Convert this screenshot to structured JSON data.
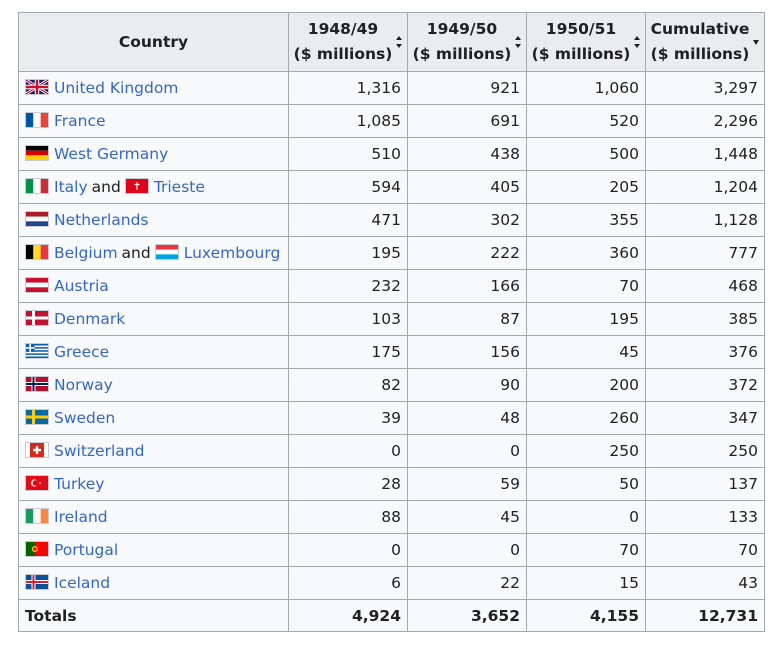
{
  "table": {
    "headers": {
      "country": "Country",
      "y1": [
        "1948/49",
        "($ millions)"
      ],
      "y2": [
        "1949/50",
        "($ millions)"
      ],
      "y3": [
        "1950/51",
        "($ millions)"
      ],
      "cum": [
        "Cumulative",
        "($ millions)"
      ]
    },
    "rows": [
      {
        "parts": [
          {
            "name": "United Kingdom",
            "flag": "uk-flag-icon"
          }
        ],
        "values": [
          "1,316",
          "921",
          "1,060",
          "3,297"
        ]
      },
      {
        "parts": [
          {
            "name": "France",
            "flag": "france-flag-icon"
          }
        ],
        "values": [
          "1,085",
          "691",
          "520",
          "2,296"
        ]
      },
      {
        "parts": [
          {
            "name": "West Germany",
            "flag": "germany-flag-icon"
          }
        ],
        "values": [
          "510",
          "438",
          "500",
          "1,448"
        ]
      },
      {
        "parts": [
          {
            "name": "Italy",
            "flag": "italy-flag-icon"
          },
          {
            "name": "Trieste",
            "flag": "trieste-flag-icon"
          }
        ],
        "joiner": "and",
        "values": [
          "594",
          "405",
          "205",
          "1,204"
        ]
      },
      {
        "parts": [
          {
            "name": "Netherlands",
            "flag": "netherlands-flag-icon"
          }
        ],
        "values": [
          "471",
          "302",
          "355",
          "1,128"
        ]
      },
      {
        "parts": [
          {
            "name": "Belgium",
            "flag": "belgium-flag-icon"
          },
          {
            "name": "Luxembourg",
            "flag": "luxembourg-flag-icon"
          }
        ],
        "joiner": "and",
        "values": [
          "195",
          "222",
          "360",
          "777"
        ]
      },
      {
        "parts": [
          {
            "name": "Austria",
            "flag": "austria-flag-icon"
          }
        ],
        "values": [
          "232",
          "166",
          "70",
          "468"
        ]
      },
      {
        "parts": [
          {
            "name": "Denmark",
            "flag": "denmark-flag-icon"
          }
        ],
        "values": [
          "103",
          "87",
          "195",
          "385"
        ]
      },
      {
        "parts": [
          {
            "name": "Greece",
            "flag": "greece-flag-icon"
          }
        ],
        "values": [
          "175",
          "156",
          "45",
          "376"
        ]
      },
      {
        "parts": [
          {
            "name": "Norway",
            "flag": "norway-flag-icon"
          }
        ],
        "values": [
          "82",
          "90",
          "200",
          "372"
        ]
      },
      {
        "parts": [
          {
            "name": "Sweden",
            "flag": "sweden-flag-icon"
          }
        ],
        "values": [
          "39",
          "48",
          "260",
          "347"
        ]
      },
      {
        "parts": [
          {
            "name": "Switzerland",
            "flag": "switzerland-flag-icon"
          }
        ],
        "values": [
          "0",
          "0",
          "250",
          "250"
        ]
      },
      {
        "parts": [
          {
            "name": "Turkey",
            "flag": "turkey-flag-icon"
          }
        ],
        "values": [
          "28",
          "59",
          "50",
          "137"
        ]
      },
      {
        "parts": [
          {
            "name": "Ireland",
            "flag": "ireland-flag-icon"
          }
        ],
        "values": [
          "88",
          "45",
          "0",
          "133"
        ]
      },
      {
        "parts": [
          {
            "name": "Portugal",
            "flag": "portugal-flag-icon"
          }
        ],
        "values": [
          "0",
          "0",
          "70",
          "70"
        ]
      },
      {
        "parts": [
          {
            "name": "Iceland",
            "flag": "iceland-flag-icon"
          }
        ],
        "values": [
          "6",
          "22",
          "15",
          "43"
        ]
      }
    ],
    "totals": {
      "label": "Totals",
      "values": [
        "4,924",
        "3,652",
        "4,155",
        "12,731"
      ]
    }
  },
  "colors": {
    "link": "#3366cc",
    "header_bg": "#eaecf0",
    "cell_bg": "#f8f9fa",
    "border": "#a2a9b1"
  }
}
